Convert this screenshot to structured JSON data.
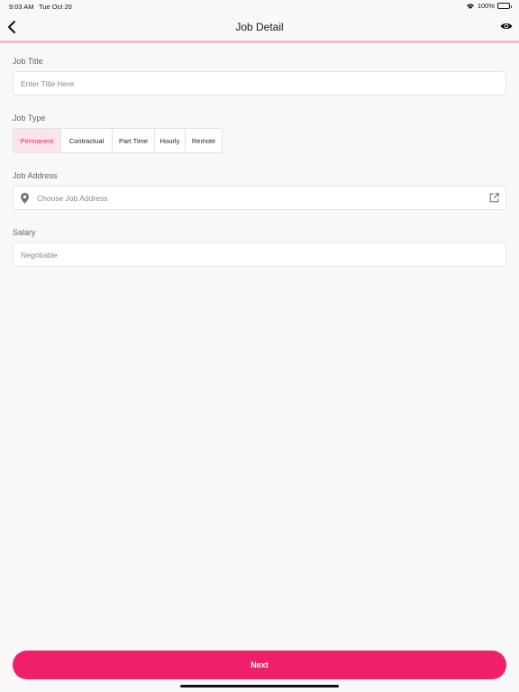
{
  "status_bar": {
    "time": "9:03 AM",
    "date": "Tue Oct 20",
    "battery": "100%"
  },
  "header": {
    "title": "Job Detail",
    "back_icon": "chevron-left-icon",
    "preview_icon": "eye-icon"
  },
  "form": {
    "job_title": {
      "label": "Job Title",
      "value": "",
      "placeholder": "Enter Title Here"
    },
    "job_type": {
      "label": "Job Type",
      "options": [
        "Permanent",
        "Contractual",
        "Part Time",
        "Hourly",
        "Remote"
      ],
      "selected": "Permanent"
    },
    "job_address": {
      "label": "Job Address",
      "value": "",
      "placeholder": "Choose Job Address"
    },
    "salary": {
      "label": "Salary",
      "value": "",
      "placeholder": "Negotiable"
    }
  },
  "footer": {
    "next_label": "Next"
  },
  "colors": {
    "accent": "#ef1f6b",
    "accent_light": "#fce4ec",
    "divider": "#f3bcd3"
  }
}
